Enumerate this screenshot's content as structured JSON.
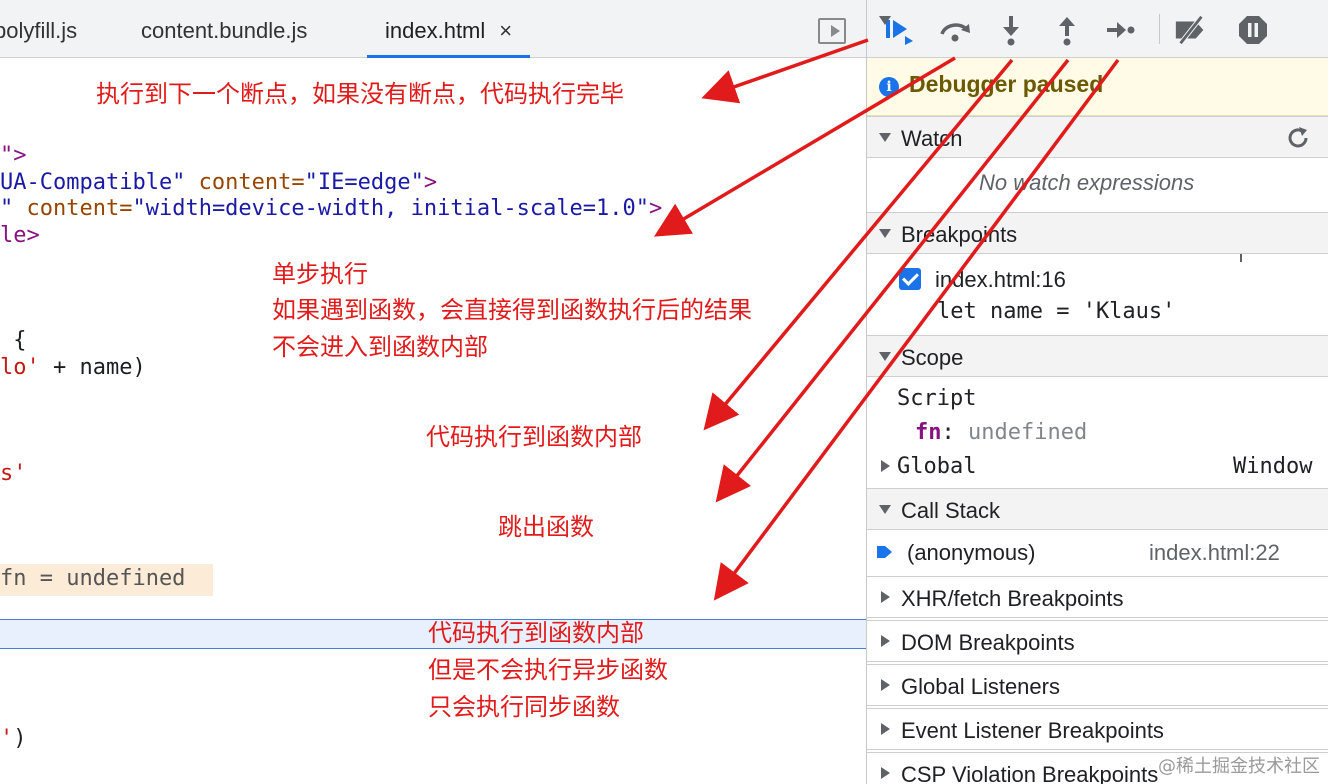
{
  "editor": {
    "tabs": [
      {
        "label": "polyfill.js",
        "active": false
      },
      {
        "label": "content.bundle.js",
        "active": false
      },
      {
        "label": "index.html",
        "active": true,
        "close": "×"
      }
    ],
    "code_lines": {
      "l1": "\">",
      "l2a": "UA-Compatible\"",
      "l2b": " content=",
      "l2c": "\"IE=edge\"",
      "l2d": ">",
      "l3a": "\"",
      "l3b": " content=",
      "l3c": "\"width=device-width, initial-scale=1.0\"",
      "l3d": ">",
      "l4a": "le",
      "l4b": ">",
      "l5": " {",
      "l6a": "lo'",
      "l6b": " + name)",
      "l7": "s'",
      "l8": "fn = undefined",
      "l9a": "'",
      "l9b": ")"
    }
  },
  "annotations": {
    "resume": "执行到下一个断点，如果没有断点，代码执行完毕",
    "step_over_1": "单步执行",
    "step_over_2": "如果遇到函数，会直接得到函数执行后的结果",
    "step_over_3": "不会进入到函数内部",
    "step_into": "代码执行到函数内部",
    "step_out": "跳出函数",
    "step_1": "代码执行到函数内部",
    "step_2": "但是不会执行异步函数",
    "step_3": "只会执行同步函数"
  },
  "debugger": {
    "toolbar_icons": [
      "resume-icon",
      "step-over-icon",
      "step-into-icon",
      "step-out-icon",
      "step-icon",
      "deactivate-breakpoints-icon",
      "pause-on-exceptions-icon"
    ],
    "paused_banner": "Debugger paused",
    "sections": {
      "watch": {
        "label": "Watch",
        "empty": "No watch expressions"
      },
      "breakpoints": {
        "label": "Breakpoints",
        "item_file": "index.html:16",
        "item_code": "let name = 'Klaus'",
        "checked": true
      },
      "scope": {
        "label": "Scope",
        "script": "Script",
        "var_name": "fn",
        "var_sep": ":",
        "var_value": "undefined",
        "global": "Global",
        "global_value": "Window"
      },
      "call_stack": {
        "label": "Call Stack",
        "frame": "(anonymous)",
        "location": "index.html:22"
      },
      "xhr": "XHR/fetch Breakpoints",
      "dom": "DOM Breakpoints",
      "global_listeners": "Global Listeners",
      "event_listeners": "Event Listener Breakpoints",
      "csp": "CSP Violation Breakpoints"
    },
    "accent": "#1a73e8"
  },
  "watermark": "@稀土掘金技术社区"
}
